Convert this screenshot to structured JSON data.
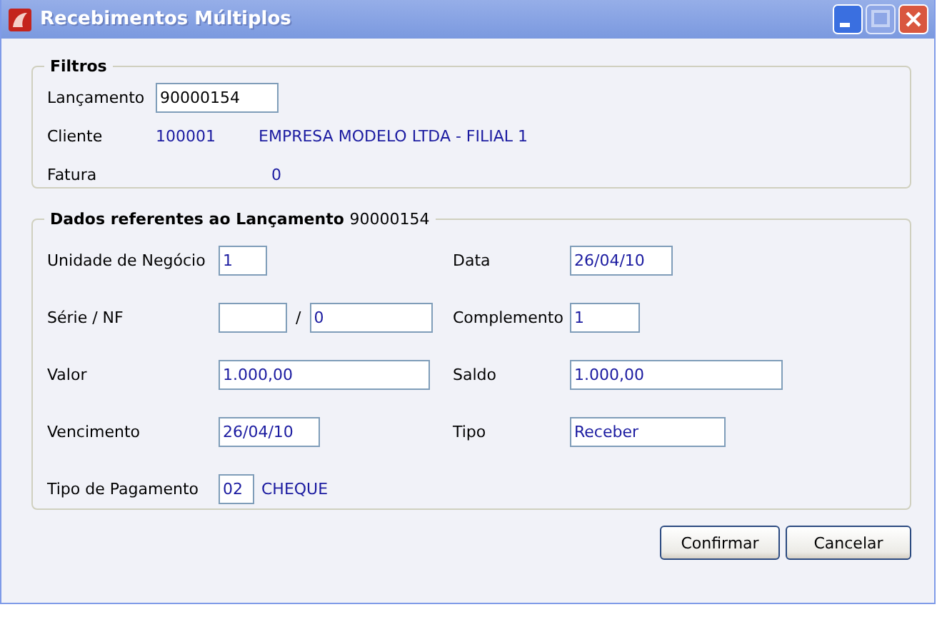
{
  "window": {
    "title": "Recebimentos Múltiplos"
  },
  "filtros": {
    "title": "Filtros",
    "lancamento": {
      "label": "Lançamento",
      "value": "90000154"
    },
    "cliente": {
      "label": "Cliente",
      "code": "100001",
      "name": "EMPRESA MODELO LTDA - FILIAL 1"
    },
    "fatura": {
      "label": "Fatura",
      "value": "0"
    }
  },
  "dados": {
    "title": "Dados referentes ao Lançamento",
    "number": "90000154",
    "rows": [
      {
        "left": {
          "kind": "field",
          "label": "Unidade de Negócio",
          "value": "1"
        },
        "right": {
          "kind": "field",
          "label": "Data",
          "value": "26/04/10"
        }
      },
      {
        "left": {
          "kind": "pair",
          "label": "Série / NF",
          "separator": "/",
          "second": "0"
        },
        "right": {
          "kind": "field",
          "label": "Complemento",
          "value": "1"
        }
      },
      {
        "left": {
          "kind": "field",
          "label": "Valor",
          "value": "1.000,00"
        },
        "right": {
          "kind": "field",
          "label": "Saldo",
          "value": "1.000,00"
        }
      },
      {
        "left": {
          "kind": "field",
          "label": "Vencimento",
          "value": "26/04/10"
        },
        "right": {
          "kind": "field",
          "label": "Tipo",
          "value": "Receber"
        }
      },
      {
        "left": {
          "kind": "code",
          "label": "Tipo de Pagamento",
          "value": "02",
          "description": "CHEQUE"
        }
      }
    ]
  },
  "buttons": [
    "Confirmar",
    "Cancelar"
  ]
}
